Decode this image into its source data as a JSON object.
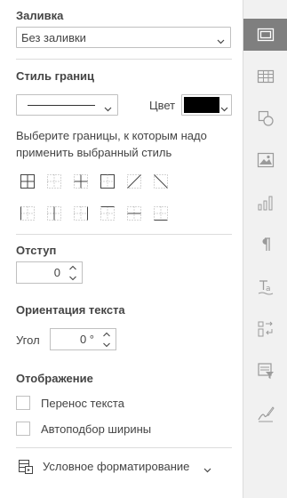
{
  "fill": {
    "title": "Заливка",
    "value": "Без заливки"
  },
  "borders": {
    "title": "Стиль границ",
    "color_label": "Цвет",
    "color": "#000000",
    "hint": "Выберите границы, к которым надо применить выбранный стиль",
    "buttons_row1": [
      "all-borders-icon",
      "no-borders-icon",
      "inner-borders-icon",
      "outer-borders-icon",
      "diagonal-up-icon",
      "diagonal-down-icon"
    ],
    "buttons_row2": [
      "left-border-icon",
      "inner-vertical-icon",
      "right-border-icon",
      "top-border-icon",
      "inner-horizontal-icon",
      "bottom-border-icon"
    ]
  },
  "indent": {
    "title": "Отступ",
    "value": "0"
  },
  "orientation": {
    "title": "Ориентация текста",
    "angle_label": "Угол",
    "angle_value": "0 °"
  },
  "display": {
    "title": "Отображение",
    "wrap_label": "Перенос текста",
    "autofit_label": "Автоподбор ширины"
  },
  "conditional": {
    "label": "Условное форматирование"
  },
  "sidebar": {
    "items": [
      "cell-settings-icon",
      "table-icon",
      "shape-icon",
      "image-icon",
      "chart-icon",
      "paragraph-icon",
      "text-art-icon",
      "pivot-icon",
      "slicer-icon",
      "signature-icon"
    ],
    "active": 0
  }
}
